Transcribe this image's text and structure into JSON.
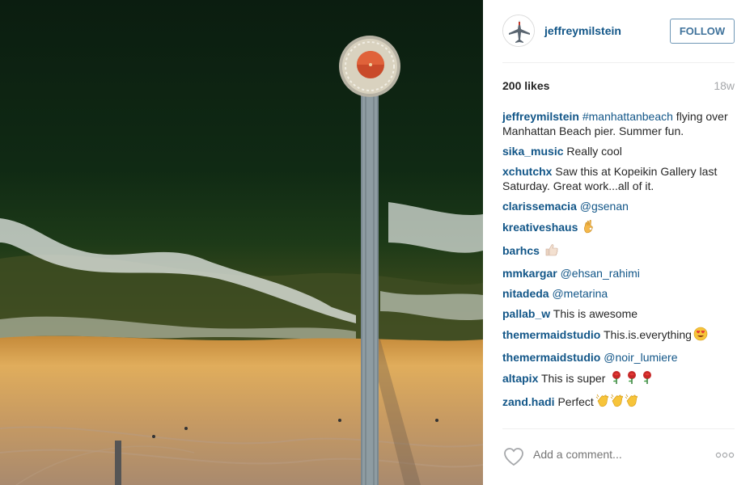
{
  "post": {
    "username": "jeffreymilstein",
    "follow_label": "FOLLOW",
    "likes": "200 likes",
    "age": "18w",
    "comment_placeholder": "Add a comment..."
  },
  "comments": [
    {
      "user": "jeffreymilstein",
      "mention": "#manhattanbeach",
      "text": " flying over Manhattan Beach pier. Summer fun.",
      "emoji": ""
    },
    {
      "user": "sika_music",
      "mention": "",
      "text": " Really cool",
      "emoji": ""
    },
    {
      "user": "xchutchx",
      "mention": "",
      "text": " Saw this at Kopeikin Gallery last Saturday. Great work...all of it.",
      "emoji": ""
    },
    {
      "user": "clarissemacia",
      "mention": "@gsenan",
      "text": "",
      "emoji": ""
    },
    {
      "user": "kreativeshaus",
      "mention": "",
      "text": " ",
      "emoji": "ok-hand-emoji"
    },
    {
      "user": "barhcs",
      "mention": "",
      "text": " ",
      "emoji": "thumbs-up-emoji"
    },
    {
      "user": "mmkargar",
      "mention": "@ehsan_rahimi",
      "text": "",
      "emoji": ""
    },
    {
      "user": "nitadeda",
      "mention": "@metarina",
      "text": "",
      "emoji": ""
    },
    {
      "user": "pallab_w",
      "mention": "",
      "text": " This is awesome",
      "emoji": ""
    },
    {
      "user": "themermaidstudio",
      "mention": "",
      "text": " This.is.everything",
      "emoji": "heart-eyes-emoji"
    },
    {
      "user": "themermaidstudio",
      "mention": "@noir_lumiere",
      "text": "",
      "emoji": ""
    },
    {
      "user": "altapix",
      "mention": "",
      "text": " This is super ",
      "emoji": "rose-emoji-x3"
    },
    {
      "user": "zand.hadi",
      "mention": "",
      "text": " Perfect",
      "emoji": "clap-emoji-x3"
    }
  ],
  "colors": {
    "link": "#125688",
    "follow": "#3f729b",
    "muted": "#a5a7aa",
    "ocean": "#0f2413",
    "sand": "#d9a85a"
  },
  "icons": {
    "avatar": "airplane-icon",
    "like": "heart-icon",
    "options": "more-options-icon"
  }
}
